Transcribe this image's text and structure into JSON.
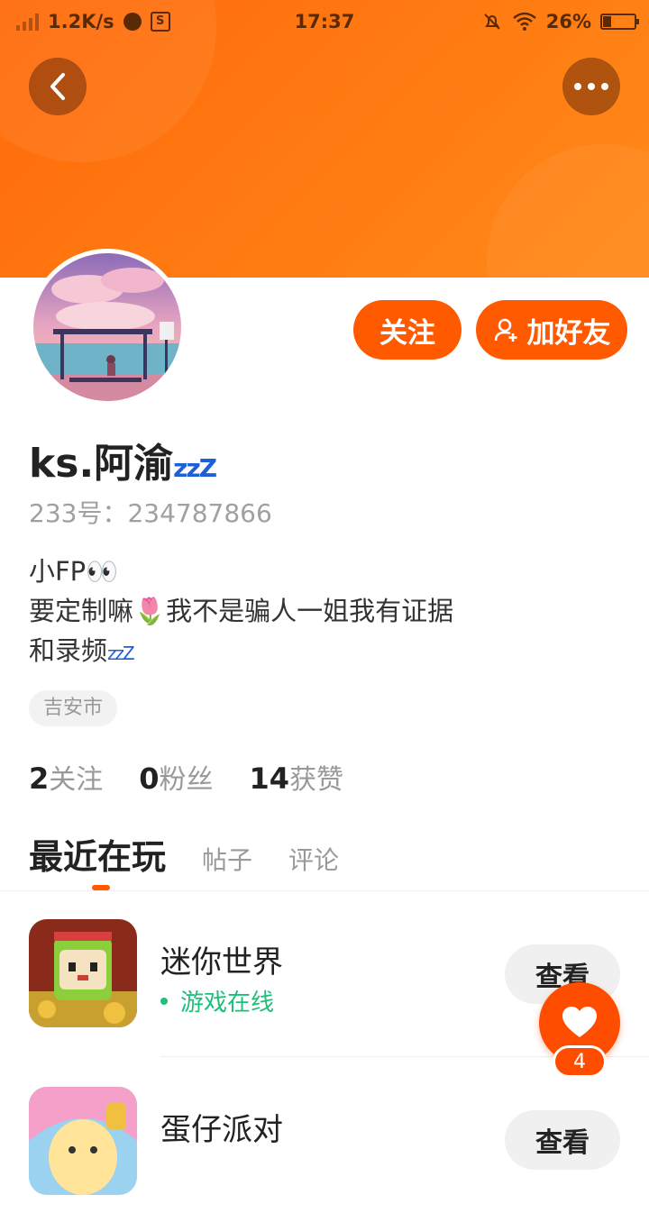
{
  "status_bar": {
    "speed": "1.2K/s",
    "time": "17:37",
    "battery_percent": "26%"
  },
  "header": {
    "back_icon": "chevron-left-icon",
    "more_icon": "more-dots-icon"
  },
  "profile": {
    "follow_label": "关注",
    "add_friend_label": "加好友",
    "username": "ks.阿渝",
    "username_suffix": "zzZ",
    "id_text": "233号：234787866",
    "bio_lines": [
      "小FP👀",
      "要定制嘛🌷我不是骗人一姐我有证据",
      "和录频"
    ],
    "bio_suffix": "zzZ",
    "location": "吉安市",
    "stats": {
      "following_count": "2",
      "following_label": "关注",
      "fans_count": "0",
      "fans_label": "粉丝",
      "likes_count": "14",
      "likes_label": "获赞"
    }
  },
  "tabs": [
    {
      "label": "最近在玩",
      "active": true
    },
    {
      "label": "帖子",
      "active": false
    },
    {
      "label": "评论",
      "active": false
    }
  ],
  "games": [
    {
      "name": "迷你世界",
      "status": "游戏在线",
      "action": "查看"
    },
    {
      "name": "蛋仔派对",
      "status": "",
      "action": "查看"
    }
  ],
  "like_fab": {
    "count": "4"
  },
  "colors": {
    "accent": "#ff5a00",
    "header": "#ff7a12",
    "online": "#1fbf7a"
  }
}
